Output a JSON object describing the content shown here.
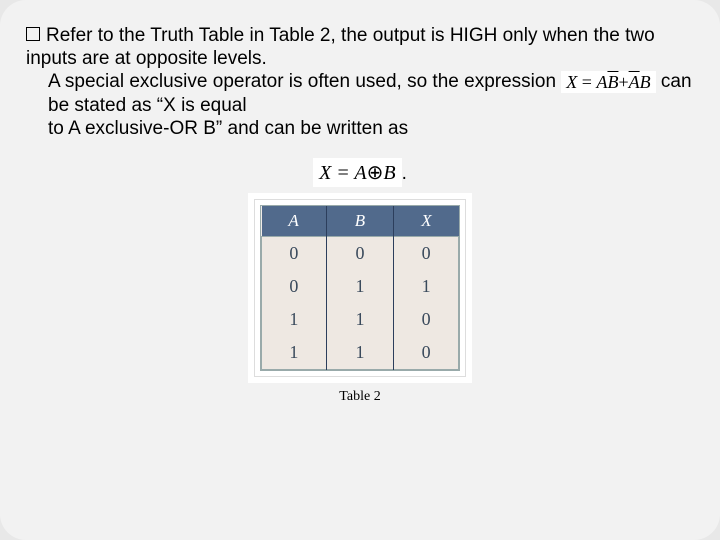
{
  "bullet_text": "Refer to the Truth Table in Table 2, the output is HIGH only when the two inputs are at opposite levels.",
  "line2_a": "A special exclusive operator is often used, so the expression ",
  "formula1": "X = AB̅ + A̅B",
  "line2_b": " can be stated as “X is equal",
  "line3": "to A exclusive-OR B” and can be written as",
  "formula2_lhs": "X = A",
  "formula2_op": "⊕",
  "formula2_rhs": "B",
  "formula2_dot": ".",
  "table_caption": "Table 2",
  "chart_data": {
    "type": "table",
    "title": "Table 2",
    "columns": [
      "A",
      "B",
      "X"
    ],
    "rows": [
      [
        "0",
        "0",
        "0"
      ],
      [
        "0",
        "1",
        "1"
      ],
      [
        "1",
        "1",
        "0"
      ],
      [
        "1",
        "1",
        "0"
      ]
    ]
  }
}
